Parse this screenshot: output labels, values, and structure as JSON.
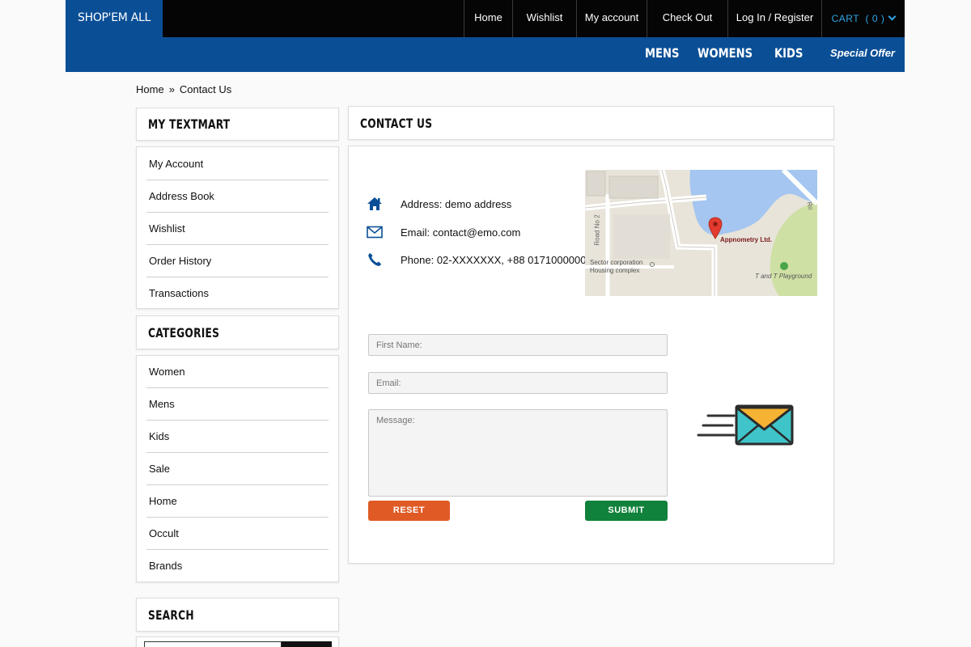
{
  "brand": {
    "logo_text": "SHOP'EM ALL"
  },
  "topnav": {
    "items": [
      "Home",
      "Wishlist",
      "My account",
      "Check Out",
      "Log In / Register"
    ],
    "cart_label": "CART  ( 0 )"
  },
  "catbar": {
    "mens": "MENS",
    "womens": "WOMENS",
    "kids": "KIDS",
    "offer": "Special Offer"
  },
  "breadcrumb": {
    "home": "Home",
    "separator": "»",
    "current": "Contact Us"
  },
  "sidebar": {
    "account_title": "MY TEXTMART",
    "account_items": [
      "My Account",
      "Address Book",
      "Wishlist",
      "Order History",
      "Transactions"
    ],
    "categories_title": "CATEGORIES",
    "category_items": [
      "Women",
      "Mens",
      "Kids",
      "Sale",
      "Home",
      "Occult",
      "Brands"
    ],
    "search_title": "SEARCH"
  },
  "contact": {
    "title": "CONTACT US",
    "address": "Address: demo address",
    "email": "Email: contact@emo.com",
    "phone": "Phone: 02-XXXXXXX, +88 0171000000",
    "map": {
      "marker_label": "Appnometry Ltd.",
      "poi_1": "Sector corporation",
      "poi_1b": "Housing complex",
      "poi_2": "T and T Playground",
      "road": "Road No 2",
      "road_2": "Ro"
    },
    "form": {
      "first_name_placeholder": "First Name:",
      "email_placeholder": "Email:",
      "message_placeholder": "Message:",
      "reset_label": "RESET",
      "submit_label": "SUBMIT"
    }
  },
  "colors": {
    "brand_blue": "#0a4f96",
    "reset": "#e05a25",
    "submit": "#11823b",
    "cart": "#2fa8e8"
  }
}
